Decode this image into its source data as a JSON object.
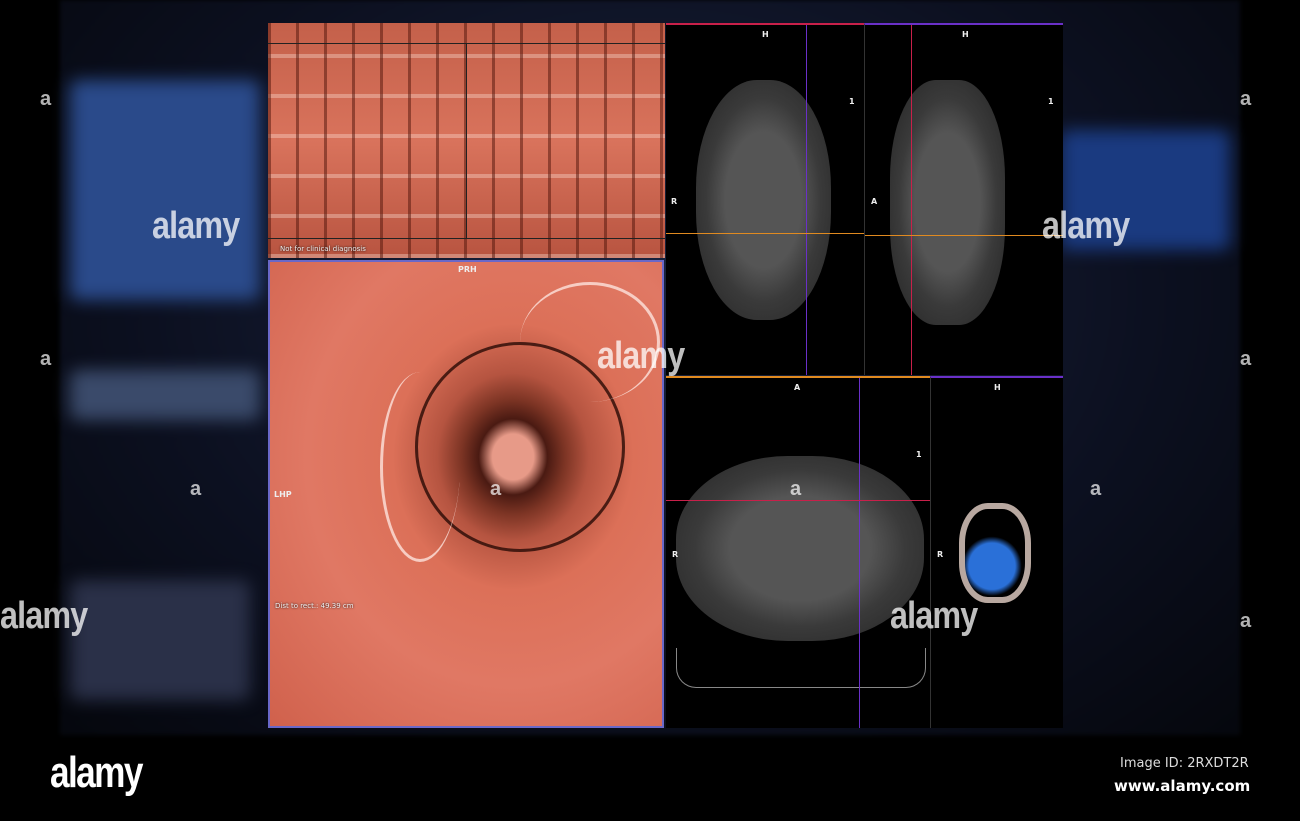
{
  "flat_view": {
    "disclaimer": "Not for clinical diagnosis"
  },
  "endo_view": {
    "orientation_top": "PRH",
    "orientation_left": "LHP",
    "distance": "Dist to rect.: 49.39 cm"
  },
  "coronal_view": {
    "orientation_top": "H",
    "orientation_left": "R",
    "slice": "1"
  },
  "sagittal_view": {
    "orientation_top": "H",
    "orientation_left": "A",
    "slice": "1"
  },
  "axial_view": {
    "orientation_top": "A",
    "orientation_left": "R",
    "slice": "1"
  },
  "volume_view": {
    "orientation_top": "H",
    "orientation_left": "R"
  },
  "watermark": {
    "brand": "alamy",
    "mark": "a",
    "image_id": "Image ID: 2RXDT2R",
    "url": "www.alamy.com"
  },
  "colors": {
    "tissue": "#d9735c",
    "border_blue": "#6a68c8",
    "crosshair_red": "#c8204a",
    "crosshair_purple": "#6a30c8",
    "crosshair_orange": "#e08a20"
  }
}
